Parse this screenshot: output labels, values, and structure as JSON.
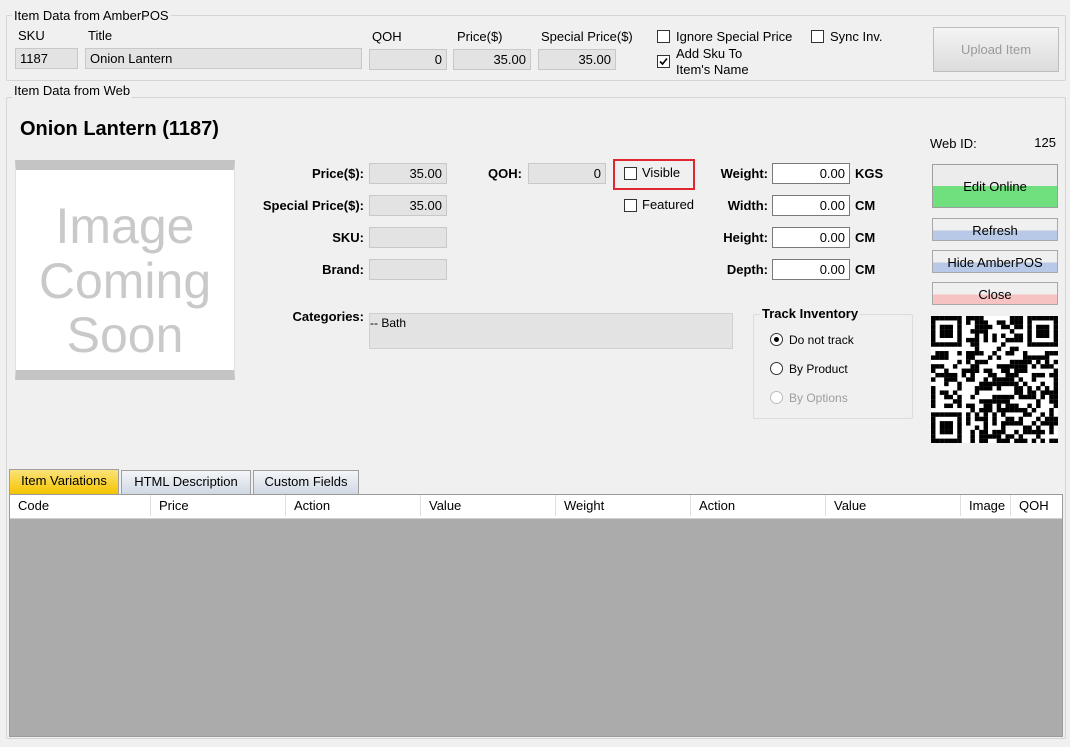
{
  "amberpos": {
    "legend": "Item Data from AmberPOS",
    "sku_label": "SKU",
    "title_label": "Title",
    "qoh_label": "QOH",
    "price_label": "Price($)",
    "special_price_label": "Special Price($)",
    "sku": "1187",
    "title": "Onion Lantern",
    "qoh": "0",
    "price": "35.00",
    "special_price": "35.00",
    "ignore_special_price": {
      "label": "Ignore Special Price",
      "checked": false
    },
    "sync_inv": {
      "label": "Sync Inv.",
      "checked": false
    },
    "add_sku": {
      "label_line1": "Add Sku To",
      "label_line2": "Item's Name",
      "checked": true
    },
    "upload_button": "Upload Item"
  },
  "web": {
    "legend": "Item Data from Web",
    "heading": "Onion Lantern (1187)",
    "web_id_label": "Web ID:",
    "web_id": "125",
    "image_placeholder": {
      "line1": "Image",
      "line2": "Coming",
      "line3": "Soon"
    },
    "price_label": "Price($):",
    "price": "35.00",
    "special_price_label": "Special Price($):",
    "special_price": "35.00",
    "sku_label": "SKU:",
    "sku": "",
    "brand_label": "Brand:",
    "brand": "",
    "qoh_label": "QOH:",
    "qoh": "0",
    "visible": {
      "label": "Visible",
      "checked": false
    },
    "featured": {
      "label": "Featured",
      "checked": false
    },
    "weight_label": "Weight:",
    "weight": "0.00",
    "weight_unit": "KGS",
    "width_label": "Width:",
    "width": "0.00",
    "width_unit": "CM",
    "height_label": "Height:",
    "height": "0.00",
    "height_unit": "CM",
    "depth_label": "Depth:",
    "depth": "0.00",
    "depth_unit": "CM",
    "categories_label": "Categories:",
    "categories_value": "-- Bath",
    "track_inventory": {
      "legend": "Track Inventory",
      "options": [
        "Do not track",
        "By Product",
        "By Options"
      ],
      "selected": "Do not track"
    }
  },
  "actions": {
    "edit_online": "Edit Online",
    "refresh": "Refresh",
    "hide_amberpos": "Hide AmberPOS",
    "close": "Close"
  },
  "tabs": [
    "Item Variations",
    "HTML Description",
    "Custom Fields"
  ],
  "active_tab": "Item Variations",
  "grid": {
    "columns": [
      "Code",
      "Price",
      "Action",
      "Value",
      "Weight",
      "Action",
      "Value",
      "Image",
      "QOH"
    ],
    "rows": []
  },
  "colors": {
    "highlight_border": "#e0262e",
    "active_tab": "#f5c400",
    "edit_online_green": "#6fe07d",
    "refresh_blue": "#b7c9e6",
    "close_red": "#f7c2c2",
    "grid_body": "#ababab"
  }
}
